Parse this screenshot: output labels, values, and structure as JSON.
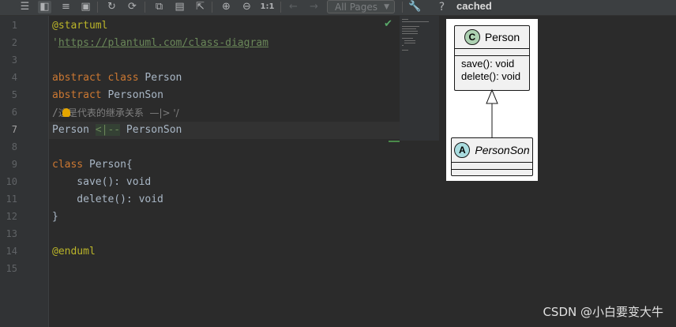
{
  "toolbar": {
    "icons": [
      "menu-icon",
      "split-view-icon",
      "list-icon",
      "image-icon",
      "refresh-icon",
      "sync-icon",
      "copy-icon",
      "save-icon",
      "export-icon",
      "zoom-in-icon",
      "zoom-out-icon",
      "actual-size-icon",
      "prev-page-icon",
      "next-page-icon",
      "dropdown-icon",
      "settings-icon",
      "help-icon"
    ],
    "actual_size_label": "1:1",
    "pages_select": "All Pages",
    "help_label": "?",
    "status": "cached"
  },
  "editor": {
    "line_numbers": [
      "1",
      "2",
      "3",
      "4",
      "5",
      "6",
      "7",
      "8",
      "9",
      "10",
      "11",
      "12",
      "13",
      "14",
      "15"
    ],
    "current_line": "7",
    "lines": {
      "l1": "@startuml",
      "l2_quote": "'",
      "l2_link": "https://plantuml.com/class-diagram",
      "l4_kw1": "abstract",
      "l4_kw2": "class",
      "l4_name": "Person",
      "l5_kw": "abstract",
      "l5_name": "PersonSon",
      "l6_prefix": "/",
      "l6_comment": "这是代表的继承关系  —|> '/",
      "l7_a": "Person ",
      "l7_arrow": "<|--",
      "l7_b": " PersonSon",
      "l9_kw": "class",
      "l9_name": " Person{",
      "l10": "    save(): void",
      "l11": "    delete(): void",
      "l12": "}",
      "l14": "@enduml"
    }
  },
  "diagram": {
    "class_person": {
      "stereotype_letter": "C",
      "name": "Person",
      "methods": [
        "save(): void",
        "delete(): void"
      ]
    },
    "class_personson": {
      "stereotype_letter": "A",
      "name": "PersonSon"
    }
  },
  "watermark": "CSDN @小白要变大牛",
  "colors": {
    "keyword": "#cc7832",
    "annotation": "#bbb529",
    "string": "#6a8759",
    "text": "#a9b7c6",
    "comment": "#808080"
  }
}
